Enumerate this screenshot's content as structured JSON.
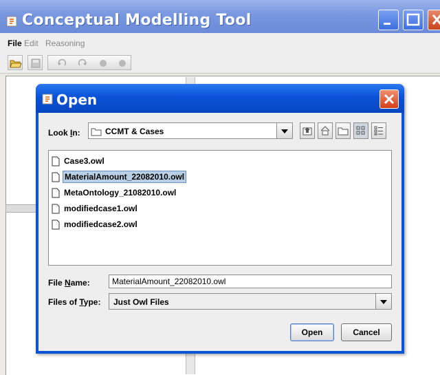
{
  "window": {
    "title": "Conceptual Modelling Tool"
  },
  "menubar": {
    "items": [
      {
        "label": "File",
        "enabled": true
      },
      {
        "label": "Edit",
        "enabled": false
      },
      {
        "label": "Reasoning",
        "enabled": false
      }
    ]
  },
  "toolbar": {
    "icons": [
      "open-folder-icon",
      "save-icon",
      "undo-icon",
      "redo-icon",
      "circle-icon",
      "circle-icon"
    ]
  },
  "dialog": {
    "title": "Open",
    "look_in": {
      "label": "Look In:",
      "value": "CCMT & Cases"
    },
    "nav_icons": [
      "up-folder-icon",
      "home-icon",
      "new-folder-icon",
      "list-view-icon",
      "details-view-icon"
    ],
    "files": [
      {
        "name": "Case3.owl",
        "selected": false
      },
      {
        "name": "MaterialAmount_22082010.owl",
        "selected": true
      },
      {
        "name": "MetaOntology_21082010.owl",
        "selected": false
      },
      {
        "name": "modifiedcase1.owl",
        "selected": false
      },
      {
        "name": "modifiedcase2.owl",
        "selected": false
      }
    ],
    "file_name": {
      "label": "File Name:",
      "value": "MaterialAmount_22082010.owl"
    },
    "file_type": {
      "label": "Files of Type:",
      "value": "Just Owl Files"
    },
    "open_label": "Open",
    "cancel_label": "Cancel"
  },
  "colors": {
    "title_bar": "#0a52d8",
    "selection": "#b8cfe5",
    "close_button": "#d4401a"
  }
}
